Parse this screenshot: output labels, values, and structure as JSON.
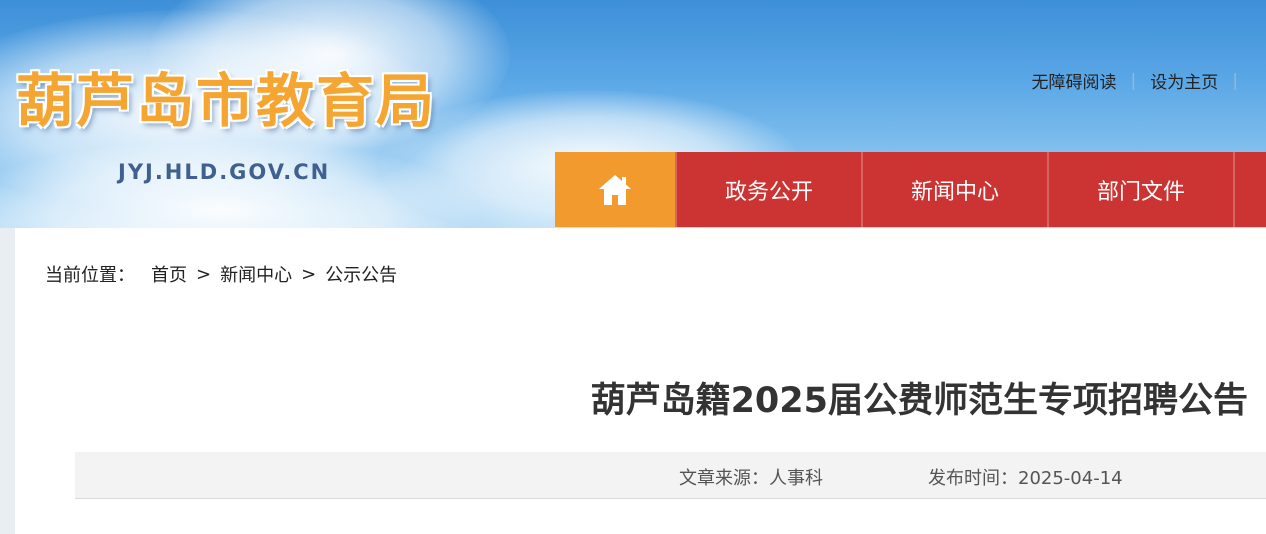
{
  "header": {
    "site_title": "葫芦岛市教育局",
    "site_domain": "JYJ.HLD.GOV.CN",
    "top_links": [
      {
        "label": "无障碍阅读"
      },
      {
        "label": "设为主页"
      }
    ],
    "separator": "|"
  },
  "nav": {
    "home_icon": "home-icon",
    "items": [
      {
        "label": "政务公开"
      },
      {
        "label": "新闻中心"
      },
      {
        "label": "部门文件"
      }
    ]
  },
  "breadcrumb": {
    "prefix": "当前位置：",
    "arrow": ">",
    "items": [
      {
        "label": "首页"
      },
      {
        "label": "新闻中心"
      },
      {
        "label": "公示公告"
      }
    ]
  },
  "article": {
    "title": "葫芦岛籍2025届公费师范生专项招聘公告",
    "source": "文章来源：人事科",
    "publish_time": "发布时间：2025-04-14"
  },
  "colors": {
    "nav_red": "#cc3333",
    "nav_home_orange": "#f29a2e",
    "title_gold": "#f5a531"
  }
}
